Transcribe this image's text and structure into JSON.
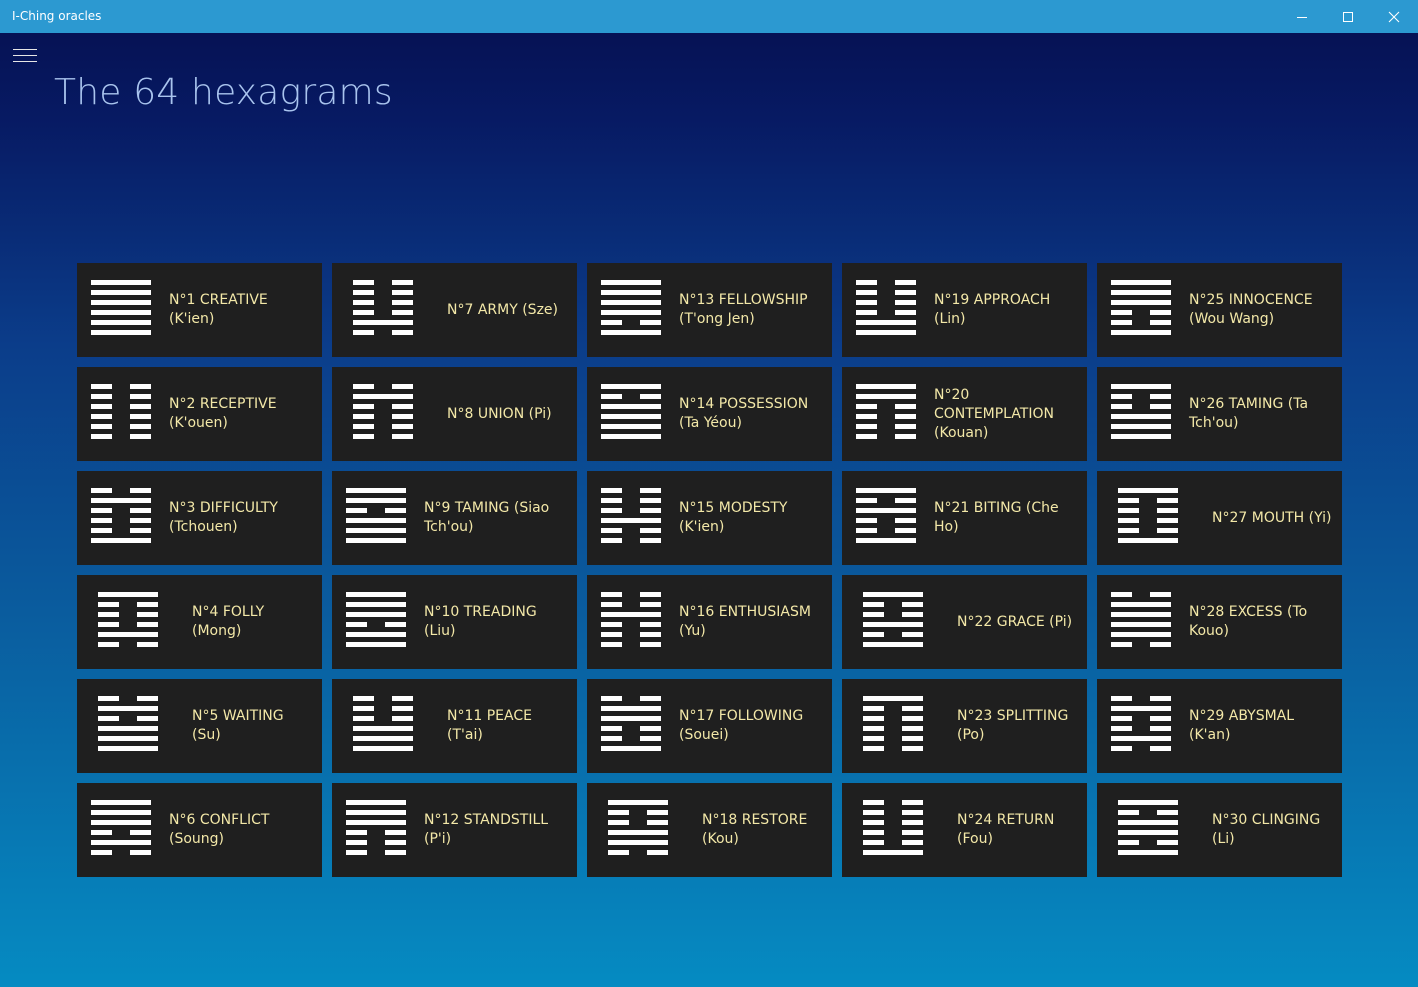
{
  "window": {
    "title": "I-Ching oracles",
    "buttons": {
      "minimize": "minimize-icon",
      "maximize": "maximize-icon",
      "close": "close-icon"
    }
  },
  "nav": {
    "menu_icon": "hamburger-menu-icon"
  },
  "page": {
    "title": "The 64 hexagrams"
  },
  "colors": {
    "titlebar": "#2c99d1",
    "tile_bg": "#1f1f1f",
    "label": "#f3e8a8",
    "title": "#a9c4ee"
  },
  "hexagrams": [
    {
      "col": 0,
      "row": 0,
      "label": "N°1 CREATIVE (K'ien)",
      "lines": "111111",
      "wide": true
    },
    {
      "col": 0,
      "row": 1,
      "label": "N°2 RECEPTIVE (K'ouen)",
      "lines": "000000",
      "wide": true
    },
    {
      "col": 0,
      "row": 2,
      "label": "N°3 DIFFICULTY (Tchouen)",
      "lines": "010001",
      "wide": true
    },
    {
      "col": 0,
      "row": 3,
      "label": "N°4 FOLLY (Mong)",
      "lines": "100010",
      "wide": false
    },
    {
      "col": 0,
      "row": 4,
      "label": "N°5 WAITING (Su)",
      "lines": "010111",
      "wide": false
    },
    {
      "col": 0,
      "row": 5,
      "label": "N°6 CONFLICT (Soung)",
      "lines": "111010",
      "wide": true
    },
    {
      "col": 1,
      "row": 0,
      "label": "N°7 ARMY (Sze)",
      "lines": "000010",
      "wide": false
    },
    {
      "col": 1,
      "row": 1,
      "label": "N°8 UNION (Pi)",
      "lines": "010000",
      "wide": false
    },
    {
      "col": 1,
      "row": 2,
      "label": "N°9 TAMING (Siao Tch'ou)",
      "lines": "110111",
      "wide": true
    },
    {
      "col": 1,
      "row": 3,
      "label": "N°10 TREADING (Liu)",
      "lines": "111011",
      "wide": true
    },
    {
      "col": 1,
      "row": 4,
      "label": "N°11 PEACE (T'ai)",
      "lines": "000111",
      "wide": false
    },
    {
      "col": 1,
      "row": 5,
      "label": "N°12 STANDSTILL (P'i)",
      "lines": "111000",
      "wide": true
    },
    {
      "col": 2,
      "row": 0,
      "label": "N°13 FELLOWSHIP (T'ong Jen)",
      "lines": "111101",
      "wide": true
    },
    {
      "col": 2,
      "row": 1,
      "label": "N°14 POSSESSION (Ta Yéou)",
      "lines": "101111",
      "wide": true
    },
    {
      "col": 2,
      "row": 2,
      "label": "N°15 MODESTY (K'ien)",
      "lines": "000100",
      "wide": true
    },
    {
      "col": 2,
      "row": 3,
      "label": "N°16 ENTHUSIASM (Yu)",
      "lines": "001000",
      "wide": true
    },
    {
      "col": 2,
      "row": 4,
      "label": "N°17 FOLLOWING (Souei)",
      "lines": "011001",
      "wide": true
    },
    {
      "col": 2,
      "row": 5,
      "label": "N°18 RESTORE (Kou)",
      "lines": "100110",
      "wide": false
    },
    {
      "col": 3,
      "row": 0,
      "label": "N°19 APPROACH (Lin)",
      "lines": "000011",
      "wide": true
    },
    {
      "col": 3,
      "row": 1,
      "label": "N°20 CONTEMPLATION (Kouan)",
      "lines": "110000",
      "wide": true
    },
    {
      "col": 3,
      "row": 2,
      "label": "N°21 BITING (Che Ho)",
      "lines": "101001",
      "wide": true
    },
    {
      "col": 3,
      "row": 3,
      "label": "N°22 GRACE (Pi)",
      "lines": "100101",
      "wide": false
    },
    {
      "col": 3,
      "row": 4,
      "label": "N°23 SPLITTING (Po)",
      "lines": "100000",
      "wide": false
    },
    {
      "col": 3,
      "row": 5,
      "label": "N°24 RETURN (Fou)",
      "lines": "000001",
      "wide": false
    },
    {
      "col": 4,
      "row": 0,
      "label": "N°25 INNOCENCE (Wou Wang)",
      "lines": "111001",
      "wide": true
    },
    {
      "col": 4,
      "row": 1,
      "label": "N°26 TAMING (Ta Tch'ou)",
      "lines": "100111",
      "wide": true
    },
    {
      "col": 4,
      "row": 2,
      "label": "N°27 MOUTH (Yi)",
      "lines": "100001",
      "wide": false
    },
    {
      "col": 4,
      "row": 3,
      "label": "N°28 EXCESS (To Kouo)",
      "lines": "011110",
      "wide": true
    },
    {
      "col": 4,
      "row": 4,
      "label": "N°29 ABYSMAL (K'an)",
      "lines": "010010",
      "wide": true
    },
    {
      "col": 4,
      "row": 5,
      "label": "N°30 CLINGING (Li)",
      "lines": "101101",
      "wide": false
    }
  ]
}
